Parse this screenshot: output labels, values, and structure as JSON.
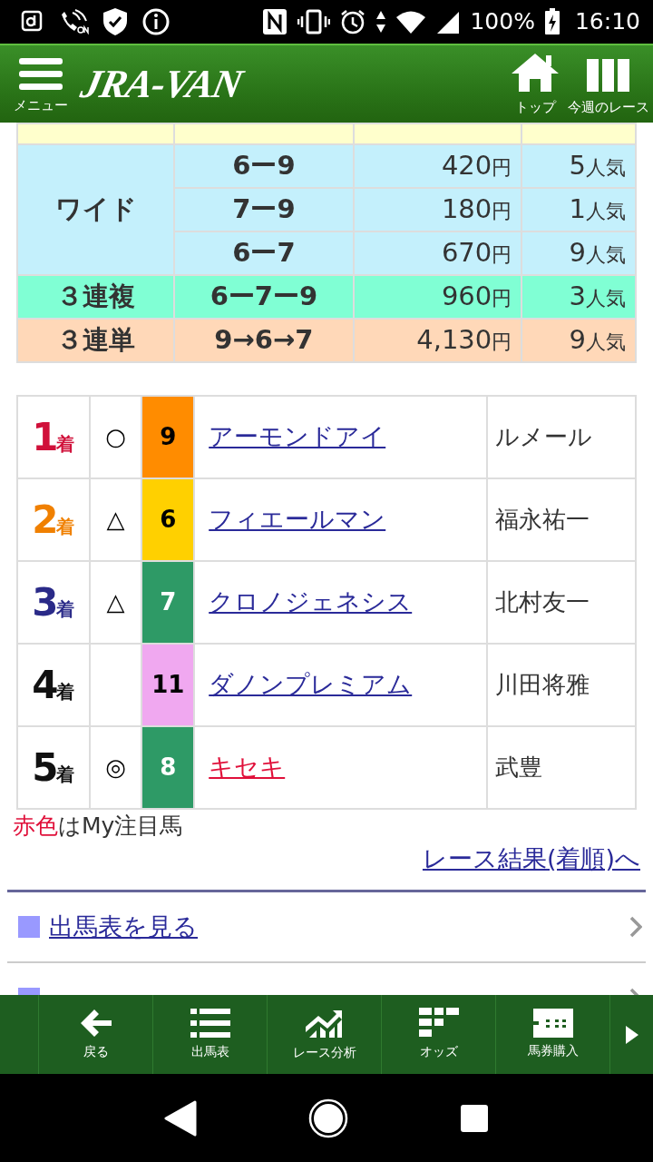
{
  "status_bar": {
    "battery": "100%",
    "time": "16:10"
  },
  "header": {
    "menu_label": "メニュー",
    "logo": "JRA-VAN",
    "actions": [
      {
        "kind": "home",
        "label": "トップ"
      },
      {
        "kind": "week",
        "label": "今週のレース"
      }
    ]
  },
  "payouts": [
    {
      "color": "#ffffcc",
      "rows": [
        {}
      ]
    },
    {
      "bet_type": "ワイド",
      "color": "#c4f0fc",
      "rows": [
        {
          "combo": "6ー9",
          "payout": "420",
          "unit": "円",
          "popularity": "5",
          "pop_unit": "人気"
        },
        {
          "combo": "7ー9",
          "payout": "180",
          "unit": "円",
          "popularity": "1",
          "pop_unit": "人気"
        },
        {
          "combo": "6ー7",
          "payout": "670",
          "unit": "円",
          "popularity": "9",
          "pop_unit": "人気"
        }
      ]
    },
    {
      "bet_type": "３連複",
      "color": "#80ffd4",
      "rows": [
        {
          "combo": "6ー7ー9",
          "payout": "960",
          "unit": "円",
          "popularity": "3",
          "pop_unit": "人気"
        }
      ]
    },
    {
      "bet_type": "３連単",
      "color": "#ffd8b8",
      "rows": [
        {
          "combo": "9→6→7",
          "payout": "4,130",
          "unit": "円",
          "popularity": "9",
          "pop_unit": "人気"
        }
      ]
    }
  ],
  "results": [
    {
      "rank": {
        "text": "1",
        "suffix": "着",
        "color": "#d0103a"
      },
      "mark": "○",
      "number": {
        "text": "9",
        "color": "#ff8c00"
      },
      "horse": "アーモンドアイ",
      "favorite": false,
      "jockey": "ルメール"
    },
    {
      "rank": {
        "text": "2",
        "suffix": "着",
        "color": "#f08000"
      },
      "mark": "△",
      "number": {
        "text": "6",
        "color": "#ffd000"
      },
      "horse": "フィエールマン",
      "favorite": false,
      "jockey": "福永祐一"
    },
    {
      "rank": {
        "text": "3",
        "suffix": "着",
        "color": "#2a2a88"
      },
      "mark": "△",
      "number": {
        "text": "7",
        "color": "#2e9a66"
      },
      "horse": "クロノジェネシス",
      "favorite": false,
      "jockey": "北村友一"
    },
    {
      "rank": {
        "text": "4",
        "suffix": "着",
        "color": "#111111"
      },
      "number": {
        "text": "11",
        "color": "#f0a8f0"
      },
      "horse": "ダノンプレミアム",
      "favorite": false,
      "jockey": "川田将雅"
    },
    {
      "rank": {
        "text": "5",
        "suffix": "着",
        "color": "#111111"
      },
      "mark": "◎",
      "number": {
        "text": "8",
        "color": "#2e9a66"
      },
      "horse": "キセキ",
      "favorite": true,
      "jockey": "武豊"
    }
  ],
  "legend": {
    "highlight": "赤色",
    "text": "はMy注目馬"
  },
  "result_link": "レース結果(着順)へ",
  "menu_links": [
    {
      "kind": "link",
      "label": "出馬表を見る"
    },
    {
      "kind": "partial"
    }
  ],
  "bottom_nav": [
    {
      "kind": "back",
      "label": "戻る"
    },
    {
      "kind": "list",
      "label": "出馬表"
    },
    {
      "kind": "chart",
      "label": "レース分析"
    },
    {
      "kind": "odds",
      "label": "オッズ"
    },
    {
      "kind": "ticket",
      "label": "馬券購入"
    }
  ]
}
